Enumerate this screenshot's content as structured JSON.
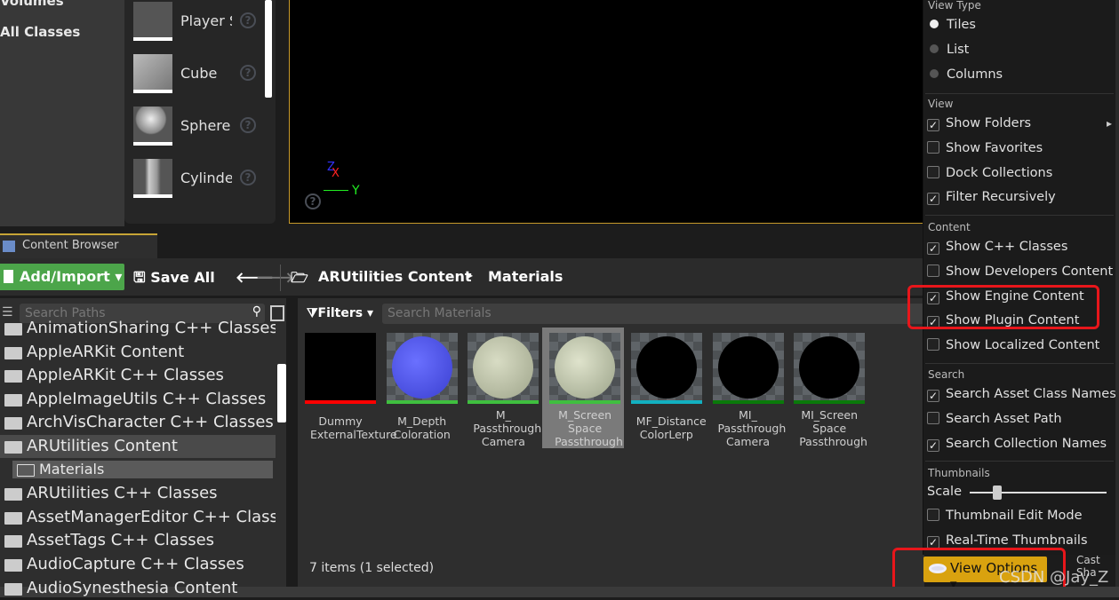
{
  "left_categories": [
    "Volumes",
    "All Classes"
  ],
  "place_items": [
    {
      "label": "Player S"
    },
    {
      "label": "Cube"
    },
    {
      "label": "Sphere"
    },
    {
      "label": "Cylinde"
    }
  ],
  "viewport": {
    "axis_x": "X",
    "axis_y": "Y",
    "axis_z": "Z"
  },
  "tab": {
    "label": "Content Browser"
  },
  "toolbar": {
    "add_import": "Add/Import",
    "save_all": "Save All",
    "breadcrumb": [
      "ARUtilities Content",
      "Materials"
    ]
  },
  "paths": {
    "search_placeholder": "Search Paths",
    "items": [
      "AnimationSharing C++ Classes",
      "AppleARKit Content",
      "AppleARKit C++ Classes",
      "AppleImageUtils C++ Classes",
      "ArchVisCharacter C++ Classes",
      "ARUtilities Content",
      "Materials",
      "ARUtilities C++ Classes",
      "AssetManagerEditor C++ Classes",
      "AssetTags C++ Classes",
      "AudioCapture C++ Classes",
      "AudioSynesthesia Content"
    ],
    "selected": "Materials"
  },
  "assets": {
    "filters_label": "Filters",
    "search_placeholder": "Search Materials",
    "status": "7 items (1 selected)",
    "items": [
      {
        "label": "Dummy ExternalTexture",
        "type_color": "#ff0000"
      },
      {
        "label": "M_Depth Coloration",
        "type_color": "#3fbf3f"
      },
      {
        "label": "M_ Passthrough Camera",
        "type_color": "#3fbf3f"
      },
      {
        "label": "M_Screen Space Passthrough",
        "type_color": "#3fbf3f",
        "selected": true
      },
      {
        "label": "MF_Distance ColorLerp",
        "type_color": "#12b0c0"
      },
      {
        "label": "MI_ Passthrough Camera",
        "type_color": "#0a7a0a"
      },
      {
        "label": "MI_Screen Space Passthrough",
        "type_color": "#0a7a0a"
      }
    ]
  },
  "view_options": {
    "sections": {
      "view_type": "View Type",
      "view": "View",
      "content": "Content",
      "search": "Search",
      "thumbnails": "Thumbnails"
    },
    "view_type": [
      {
        "label": "Tiles",
        "selected": true
      },
      {
        "label": "List",
        "selected": false
      },
      {
        "label": "Columns",
        "selected": false
      }
    ],
    "view": [
      {
        "label": "Show Folders",
        "checked": true
      },
      {
        "label": "Show Favorites",
        "checked": false
      },
      {
        "label": "Dock Collections",
        "checked": false
      },
      {
        "label": "Filter Recursively",
        "checked": true
      }
    ],
    "content": [
      {
        "label": "Show C++ Classes",
        "checked": true
      },
      {
        "label": "Show Developers Content",
        "checked": false
      },
      {
        "label": "Show Engine Content",
        "checked": true
      },
      {
        "label": "Show Plugin Content",
        "checked": true
      },
      {
        "label": "Show Localized Content",
        "checked": false
      }
    ],
    "search": [
      {
        "label": "Search Asset Class Names",
        "checked": true
      },
      {
        "label": "Search Asset Path",
        "checked": false
      },
      {
        "label": "Search Collection Names",
        "checked": true
      }
    ],
    "scale_label": "Scale",
    "scale_value": 0.2,
    "thumbs": [
      {
        "label": "Thumbnail Edit Mode",
        "checked": false
      },
      {
        "label": "Real-Time Thumbnails",
        "checked": true
      }
    ],
    "button": "View Options"
  },
  "behind_text": "Cast Sha",
  "watermark": "CSDN @Jay_Z"
}
